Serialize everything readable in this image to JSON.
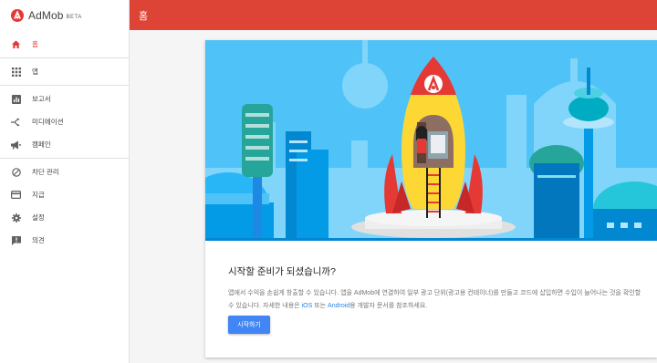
{
  "brand": {
    "name": "AdMob",
    "badge": "BETA"
  },
  "header": {
    "title": "홈"
  },
  "sidebar": {
    "groups": [
      [
        {
          "label": "홈",
          "icon": "home-icon",
          "active": true
        }
      ],
      [
        {
          "label": "앱",
          "icon": "apps-grid-icon"
        }
      ],
      [
        {
          "label": "보고서",
          "icon": "bar-chart-icon"
        },
        {
          "label": "미디에이션",
          "icon": "mediation-icon"
        },
        {
          "label": "캠페인",
          "icon": "megaphone-icon"
        }
      ],
      [
        {
          "label": "차단 관리",
          "icon": "block-icon"
        },
        {
          "label": "지급",
          "icon": "payments-icon"
        },
        {
          "label": "설정",
          "icon": "gear-icon"
        },
        {
          "label": "의견",
          "icon": "feedback-icon"
        }
      ]
    ]
  },
  "main": {
    "card": {
      "title": "시작할 준비가 되셨습니까?",
      "description_part1": "앱에서 수익을 손쉽게 창출할 수 있습니다. 앱을 AdMob에 연결하여 일부 광고 단위(광고용 컨테이너)를 만들고 코드에 삽입하면 수입이 늘어나는 것을 확인할 수 있습니다. 자세한 내용은 ",
      "link_ios": "iOS",
      "description_part2": " 또는 ",
      "link_android": "Android",
      "description_part3": "용 개발자 문서를 참조하세요.",
      "button_label": "시작하기"
    }
  },
  "colors": {
    "accent": "#dd4436",
    "primary_button": "#4285f4",
    "link": "#1e88e5",
    "sky": "#4fc3f7"
  }
}
